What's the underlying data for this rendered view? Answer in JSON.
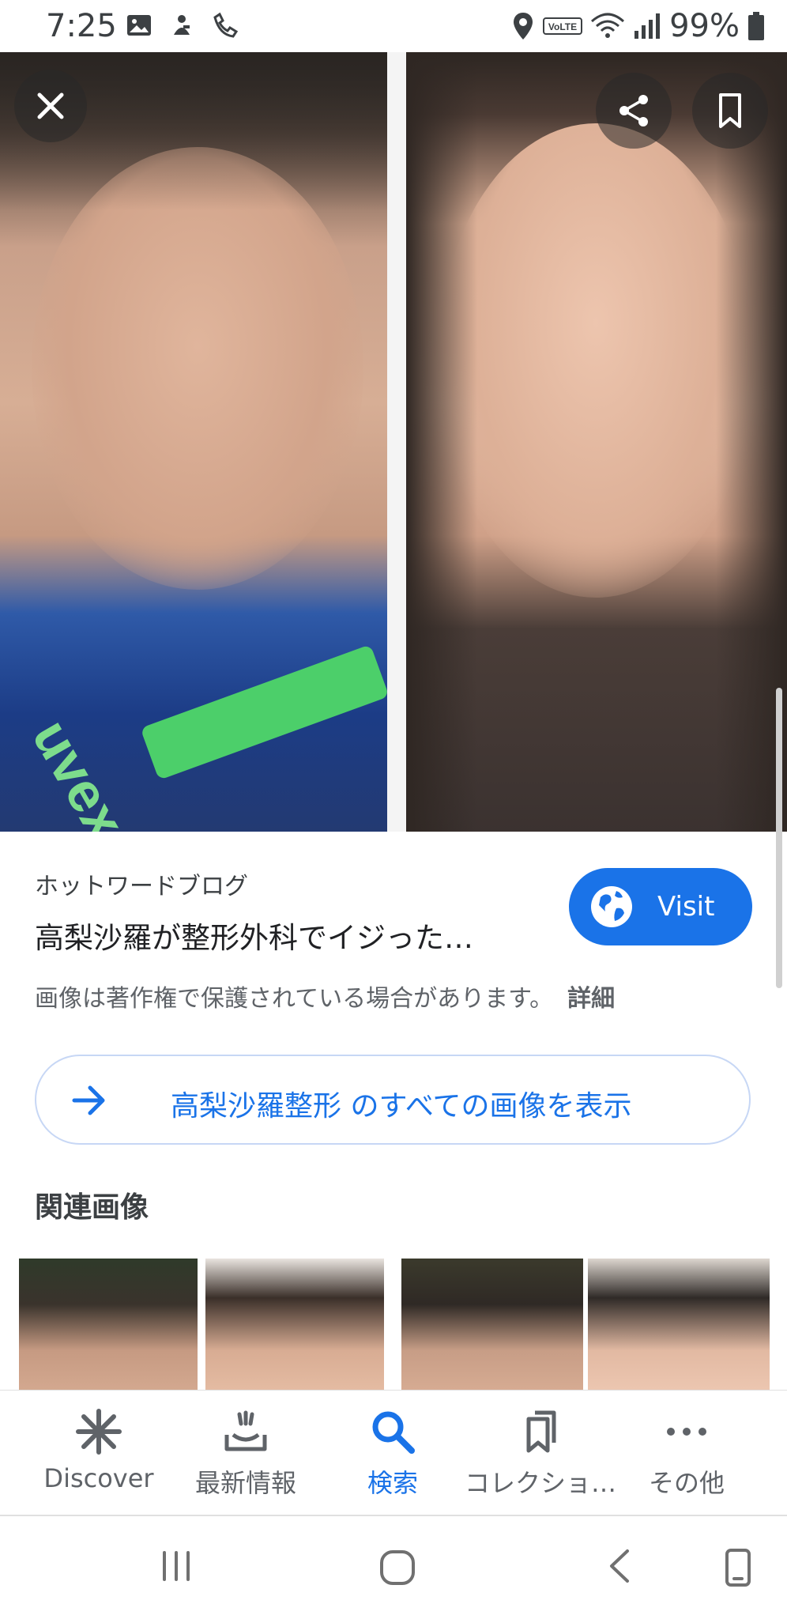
{
  "status_bar": {
    "time": "7:25",
    "battery": "99%",
    "left_icons": [
      "image-icon",
      "notification-icon",
      "handset-icon"
    ],
    "right_icons": [
      "location-icon",
      "volte-icon",
      "wifi-icon",
      "signal-icon",
      "battery-icon"
    ],
    "volte_label": "VoLTE"
  },
  "hero": {
    "close_icon": "close-icon",
    "share_icon": "share-icon",
    "bookmark_icon": "bookmark-icon",
    "left_shirt_text": "uvex"
  },
  "source": {
    "name": "ホットワードブログ",
    "title": "高梨沙羅が整形外科でイジった…",
    "visit_label": "Visit",
    "copyright": "画像は著作権で保護されている場合があります。",
    "details_label": "詳細"
  },
  "see_all": {
    "label": "高梨沙羅整形 のすべての画像を表示"
  },
  "related": {
    "heading": "関連画像"
  },
  "bottom_nav": {
    "items": [
      {
        "label": "Discover",
        "icon": "discover-icon"
      },
      {
        "label": "最新情報",
        "icon": "updates-icon"
      },
      {
        "label": "検索",
        "icon": "search-icon"
      },
      {
        "label": "コレクショ…",
        "icon": "collections-icon"
      },
      {
        "label": "その他",
        "icon": "more-icon"
      }
    ],
    "active_index": 2
  },
  "colors": {
    "accent": "#1a73e8",
    "text_primary": "#202124",
    "text_secondary": "#5f6368"
  }
}
